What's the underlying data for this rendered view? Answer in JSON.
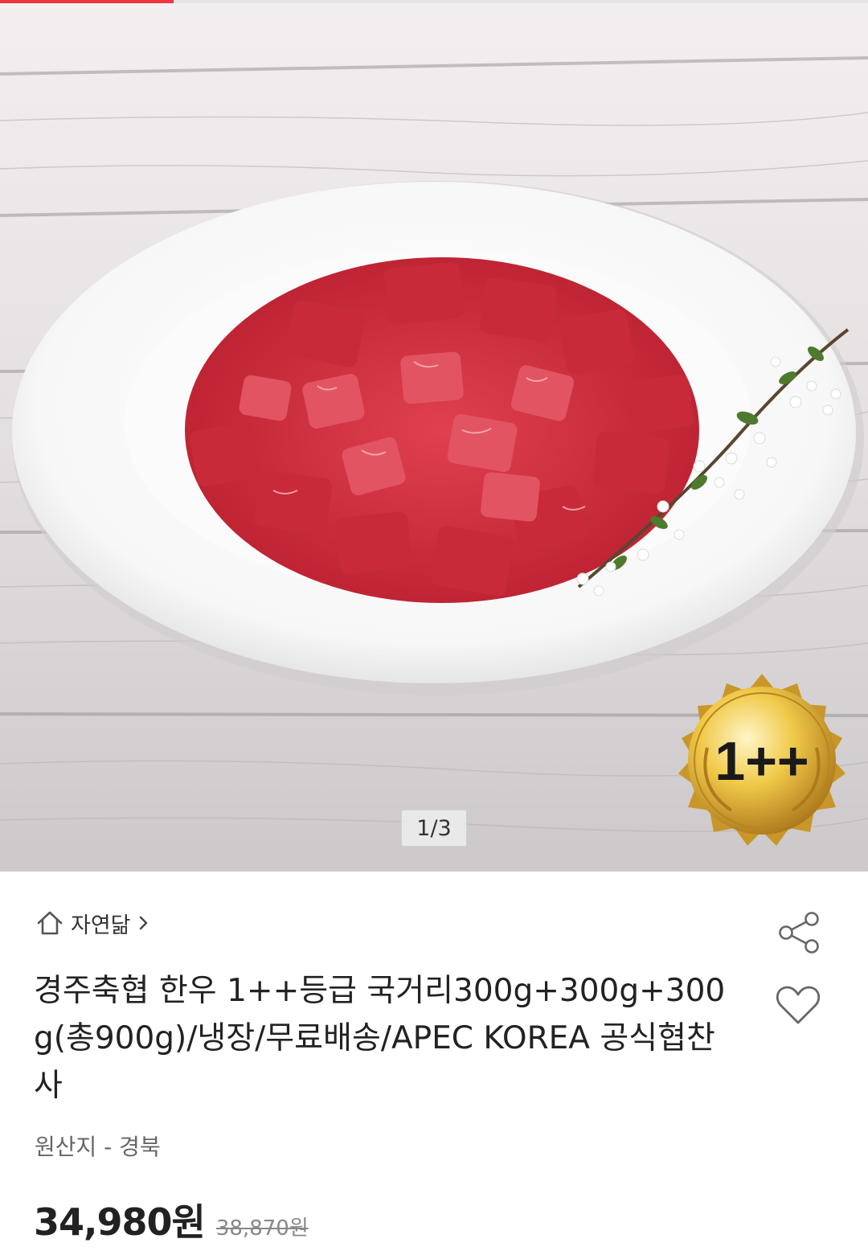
{
  "header": {
    "progress_fraction": 0.2
  },
  "gallery": {
    "pager_label": "1/3",
    "badge_text": "1++",
    "image_icon": "product-photo-diced-beef-on-plate"
  },
  "store": {
    "name": "자연닮",
    "icon": "home-icon",
    "chevron": "chevron-right-icon"
  },
  "actions": {
    "share_icon": "share-icon",
    "wishlist_icon": "heart-icon"
  },
  "product": {
    "title": "경주축협 한우 1++등급 국거리300g+300g+300g(총900g)/냉장/무료배송/APEC KOREA 공식협찬사",
    "origin": "원산지 - 경북"
  },
  "price": {
    "current": "34,980원",
    "original": "38,870원"
  },
  "colors": {
    "accent": "#f0353f",
    "text": "#222222",
    "muted": "#888888"
  }
}
